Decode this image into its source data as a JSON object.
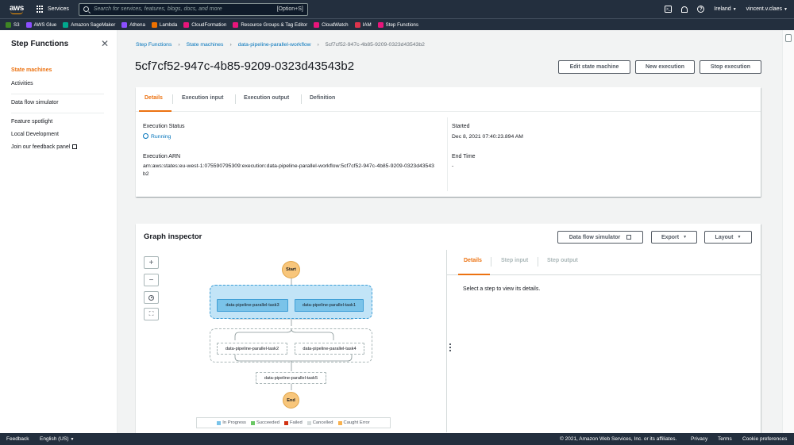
{
  "topnav": {
    "logo_text": "aws",
    "services_label": "Services",
    "search_placeholder": "Search for services, features, blogs, docs, and more",
    "search_shortcut": "[Option+S]",
    "region": "Ireland",
    "user": "vincent.v.claes"
  },
  "favorites": [
    {
      "label": "S3",
      "color": "#3f8624"
    },
    {
      "label": "AWS Glue",
      "color": "#8c4fff"
    },
    {
      "label": "Amazon SageMaker",
      "color": "#01a88d"
    },
    {
      "label": "Athena",
      "color": "#8c4fff"
    },
    {
      "label": "Lambda",
      "color": "#ed7100"
    },
    {
      "label": "CloudFormation",
      "color": "#e7157b"
    },
    {
      "label": "Resource Groups & Tag Editor",
      "color": "#e7157b"
    },
    {
      "label": "CloudWatch",
      "color": "#e7157b"
    },
    {
      "label": "IAM",
      "color": "#dd344c"
    },
    {
      "label": "Step Functions",
      "color": "#e7157b"
    }
  ],
  "sidebar": {
    "title": "Step Functions",
    "items": [
      {
        "label": "State machines"
      },
      {
        "label": "Activities"
      },
      {
        "label": "Data flow simulator"
      },
      {
        "label": "Feature spotlight"
      },
      {
        "label": "Local Development"
      },
      {
        "label": "Join our feedback panel"
      }
    ]
  },
  "breadcrumb": [
    "Step Functions",
    "State machines",
    "data-pipeline-parallel-workflow",
    "5cf7cf52-947c-4b85-9209-0323d43543b2"
  ],
  "page": {
    "title": "5cf7cf52-947c-4b85-9209-0323d43543b2",
    "buttons": {
      "edit": "Edit state machine",
      "new": "New execution",
      "stop": "Stop execution"
    }
  },
  "details": {
    "tabs": [
      "Details",
      "Execution input",
      "Execution output",
      "Definition"
    ],
    "status_label": "Execution Status",
    "status_value": "Running",
    "arn_label": "Execution ARN",
    "arn_value": "arn:aws:states:eu-west-1:075590795309:execution:data-pipeline-parallel-workflow:5cf7cf52-947c-4b85-9209-0323d43543b2",
    "started_label": "Started",
    "started_value": "Dec 8, 2021 07:40:23.894 AM",
    "end_label": "End Time",
    "end_value": "-"
  },
  "graph": {
    "title": "Graph inspector",
    "buttons": {
      "simulator": "Data flow simulator",
      "export": "Export",
      "layout": "Layout"
    },
    "zoom_controls": [
      "+",
      "−"
    ],
    "nodes": {
      "start": "Start",
      "end": "End",
      "task3": "data-pipeline-parallel-task3",
      "task1": "data-pipeline-parallel-task1",
      "task2": "data-pipeline-parallel-task2",
      "task4": "data-pipeline-parallel-task4",
      "task5": "data-pipeline-parallel-task5"
    },
    "legend": [
      {
        "label": "In Progress",
        "color": "#7ac3e9"
      },
      {
        "label": "Succeeded",
        "color": "#6ac764"
      },
      {
        "label": "Failed",
        "color": "#d13212"
      },
      {
        "label": "Cancelled",
        "color": "#d5dbdb"
      },
      {
        "label": "Caught Error",
        "color": "#f8b14f"
      }
    ],
    "side_tabs": [
      "Details",
      "Step input",
      "Step output"
    ],
    "placeholder": "Select a step to view its details."
  },
  "footer": {
    "feedback": "Feedback",
    "language": "English (US)",
    "copyright": "© 2021, Amazon Web Services, Inc. or its affiliates.",
    "privacy": "Privacy",
    "terms": "Terms",
    "cookies": "Cookie preferences"
  }
}
